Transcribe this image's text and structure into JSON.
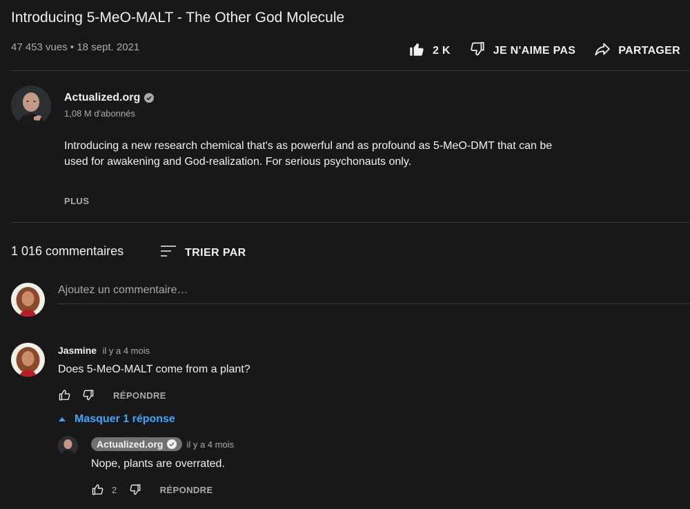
{
  "video": {
    "title": "Introducing 5-MeO-MALT - The Other God Molecule",
    "views": "47 453 vues",
    "separator": "•",
    "date": "18 sept. 2021"
  },
  "actions": {
    "like_count": "2 K",
    "dislike_label": "JE N'AIME PAS",
    "share_label": "PARTAGER",
    "like_icon": "thumbs-up-filled-icon",
    "dislike_icon": "thumbs-down-icon",
    "share_icon": "share-arrow-icon"
  },
  "channel": {
    "name": "Actualized.org",
    "subscribers": "1,08 M d'abonnés",
    "verified_icon": "check-circle-icon"
  },
  "description": {
    "text": "Introducing a new research chemical that's as powerful and as profound as 5-MeO-DMT that can be used for awakening and God-realization. For serious psychonauts only.",
    "more_label": "PLUS"
  },
  "comments": {
    "count_label": "1 016 commentaires",
    "sort_label": "TRIER PAR",
    "sort_icon": "sort-lines-icon",
    "add_placeholder": "Ajoutez un commentaire…",
    "items": [
      {
        "author": "Jasmine",
        "time": "il y a 4 mois",
        "text": "Does 5-MeO-MALT come from a plant?",
        "reply_label": "RÉPONDRE",
        "toggle_label": "Masquer 1 réponse",
        "replies": [
          {
            "author": "Actualized.org",
            "time": "il y a 4 mois",
            "text": "Nope, plants are overrated.",
            "likes": "2",
            "reply_label": "RÉPONDRE"
          }
        ]
      }
    ]
  },
  "colors": {
    "background": "#181818",
    "text": "#f1f1f1",
    "secondary": "#aaaaaa",
    "link_blue": "#3ea6ff",
    "badge": "#717171"
  }
}
